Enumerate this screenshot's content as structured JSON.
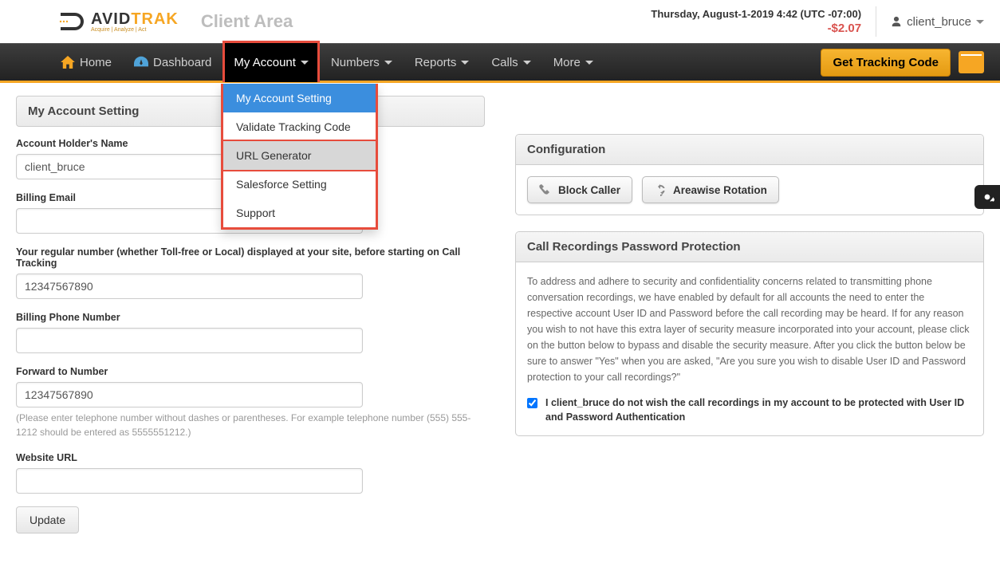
{
  "header": {
    "logo_primary": "AVID",
    "logo_secondary": "TRAK",
    "logo_sub": "Acquire | Analyze | Act",
    "area_title": "Client Area",
    "datetime": "Thursday, August-1-2019 4:42 (UTC -07:00)",
    "balance": "-$2.07",
    "username": "client_bruce"
  },
  "nav": {
    "home": "Home",
    "dashboard": "Dashboard",
    "my_account": "My Account",
    "numbers": "Numbers",
    "reports": "Reports",
    "calls": "Calls",
    "more": "More",
    "tracking_btn": "Get Tracking Code"
  },
  "dropdown": {
    "items": [
      "My Account Setting",
      "Validate Tracking Code",
      "URL Generator",
      "Salesforce Setting",
      "Support"
    ]
  },
  "left": {
    "panel_title": "My Account Setting",
    "f1_label": "Account Holder's Name",
    "f1_value": "client_bruce",
    "f2_label": "Billing Email",
    "f2_value": "",
    "f3_label": "Your regular number (whether Toll-free or Local) displayed at your site, before starting on Call Tracking",
    "f3_value": "12347567890",
    "f4_label": "Billing Phone Number",
    "f4_value": "",
    "f5_label": "Forward to Number",
    "f5_value": "12347567890",
    "f5_help": "(Please enter telephone number without dashes or parentheses. For example telephone number (555) 555-1212 should be entered as 5555551212.)",
    "f6_label": "Website URL",
    "f6_value": "",
    "update_btn": "Update"
  },
  "right": {
    "config_title": "Configuration",
    "block_caller": "Block Caller",
    "areawise": "Areawise Rotation",
    "rec_title": "Call Recordings Password Protection",
    "rec_body": "To address and adhere to security and confidentiality concerns related to transmitting phone conversation recordings, we have enabled by default for all accounts the need to enter the respective account User ID and Password before the call recording may be heard. If for any reason you wish to not have this extra layer of security measure incorporated into your account, please click on the button below to bypass and disable the security measure. After you click the button below be sure to answer \"Yes\" when you are asked, \"Are you sure you wish to disable User ID and Password protection to your call recordings?\"",
    "rec_check": "I client_bruce do not wish the call recordings in my account to be protected with User ID and Password Authentication"
  }
}
